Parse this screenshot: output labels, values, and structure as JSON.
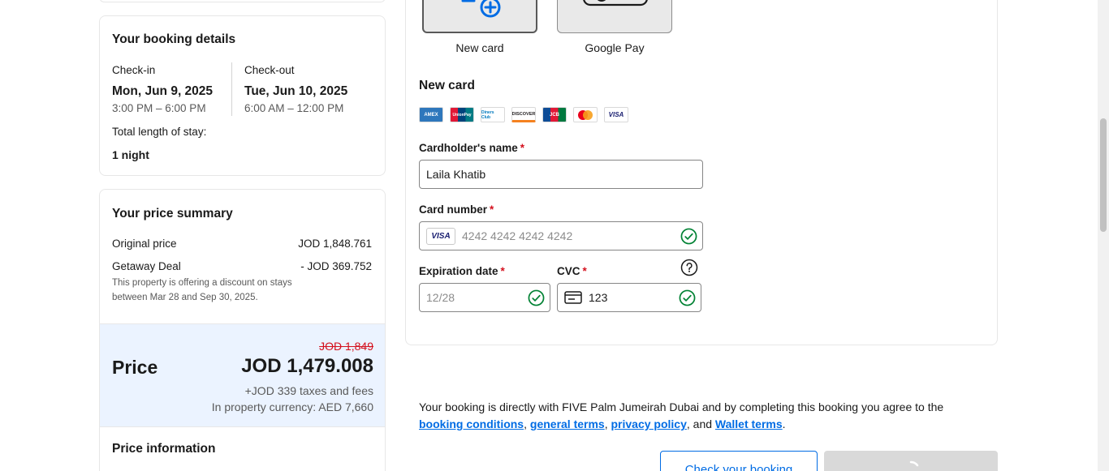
{
  "booking": {
    "title": "Your booking details",
    "checkin_label": "Check-in",
    "checkin_date": "Mon, Jun 9, 2025",
    "checkin_time": "3:00 PM – 6:00 PM",
    "checkout_label": "Check-out",
    "checkout_date": "Tue, Jun 10, 2025",
    "checkout_time": "6:00 AM – 12:00 PM",
    "stay_label": "Total length of stay:",
    "stay_value": "1 night"
  },
  "price_summary": {
    "title": "Your price summary",
    "original_label": "Original price",
    "original_value": "JOD 1,848.761",
    "deal_label": "Getaway Deal",
    "deal_value": "- JOD 369.752",
    "deal_note": "This property is offering a discount on stays between Mar 28 and Sep 30, 2025.",
    "price_label": "Price",
    "old_price": "JOD 1,849",
    "price": "JOD 1,479.008",
    "taxes": "+JOD 339 taxes and fees",
    "property_currency": "In property currency: AED 7,660",
    "info_title": "Price information"
  },
  "payment": {
    "methods": [
      {
        "label": "New card",
        "icon": "add-card-icon"
      },
      {
        "label": "Google Pay",
        "icon": "google-pay-icon"
      }
    ],
    "section_title": "New card",
    "card_brands": [
      "AMEX",
      "UnionPay",
      "Diners Club",
      "DISCOVER",
      "JCB",
      "Mastercard",
      "VISA"
    ],
    "cardholder_label": "Cardholder's name",
    "cardholder_value": "Laila Khatib",
    "card_number_label": "Card number",
    "card_number_placeholder": "4242 4242 4242 4242",
    "card_number_brand": "VISA",
    "expiry_label": "Expiration date",
    "expiry_placeholder": "12/28",
    "cvc_label": "CVC",
    "cvc_value": "123",
    "required_mark": "*"
  },
  "terms": {
    "text": "Your booking is directly with FIVE Palm Jumeirah Dubai and by completing this booking you agree to the",
    "link_booking": "booking conditions",
    "link_general": "general terms",
    "link_privacy": "privacy policy",
    "and": "and",
    "link_wallet": "Wallet terms"
  },
  "actions": {
    "check_booking": "Check your booking"
  },
  "colors": {
    "accent": "#006ce4",
    "success": "#008234",
    "danger": "#d4111e",
    "price_bg": "#ebf3ff"
  }
}
